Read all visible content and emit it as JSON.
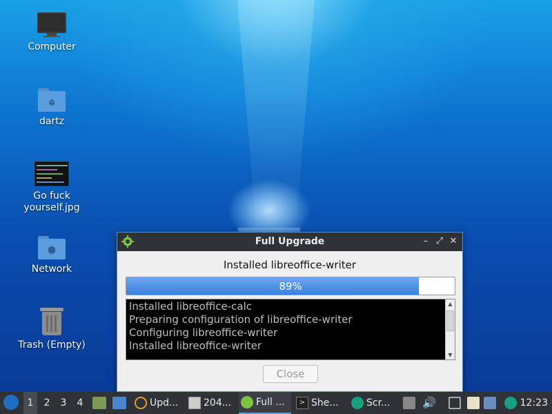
{
  "desktop": {
    "icons": [
      {
        "label": "Computer",
        "icon": "computer-icon"
      },
      {
        "label": "dartz",
        "icon": "home-folder-icon"
      },
      {
        "label": "Go fuck yourself.jpg",
        "icon": "image-file-icon"
      },
      {
        "label": "Network",
        "icon": "network-folder-icon"
      },
      {
        "label": "Trash (Empty)",
        "icon": "trash-icon"
      }
    ]
  },
  "dialog": {
    "title": "Full Upgrade",
    "status": "Installed libreoffice-writer",
    "progress_percent": 89,
    "progress_label": "89%",
    "log_lines": [
      "Installed libreoffice-calc",
      "Preparing configuration of libreoffice-writer",
      "Configuring libreoffice-writer",
      "Installed libreoffice-writer"
    ],
    "close_label": "Close"
  },
  "taskbar": {
    "workspaces": [
      "1",
      "2",
      "3",
      "4"
    ],
    "active_workspace": "1",
    "tasks": [
      {
        "label": "Upd...",
        "icon": "update-icon"
      },
      {
        "label": "204...",
        "icon": "window-icon"
      },
      {
        "label": "Full ...",
        "icon": "gear-icon",
        "active": true
      },
      {
        "label": "She...",
        "icon": "terminal-icon"
      },
      {
        "label": "Scr...",
        "icon": "screenshot-icon"
      }
    ],
    "clock": "12:23",
    "colors": {
      "bar": "#2f3237",
      "accent": "#5b9ee0"
    }
  }
}
